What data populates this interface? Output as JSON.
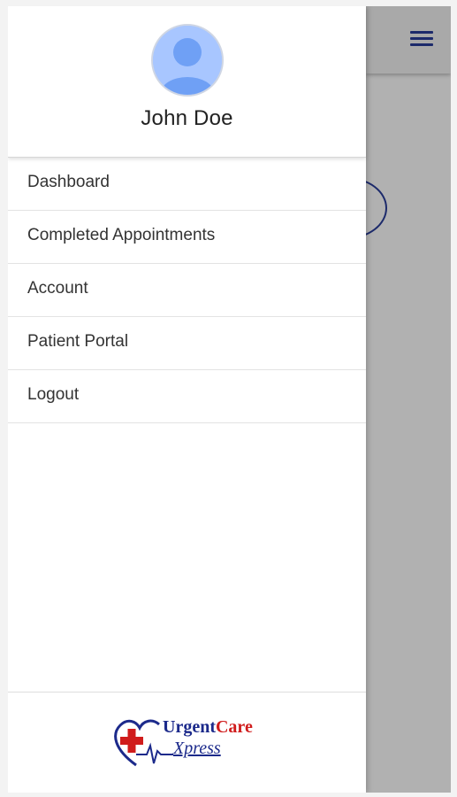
{
  "user": {
    "name": "John Doe"
  },
  "menu": {
    "items": [
      {
        "label": "Dashboard"
      },
      {
        "label": "Completed Appointments"
      },
      {
        "label": "Account"
      },
      {
        "label": "Patient Portal"
      },
      {
        "label": "Logout"
      }
    ]
  },
  "logo": {
    "urgent": "Urgent",
    "care": "Care",
    "xpress": "Xpress"
  },
  "colors": {
    "brand_blue": "#1c2a8b",
    "brand_red": "#d01c1c",
    "overlay": "#b1b1b1"
  },
  "icons": {
    "menu": "hamburger-icon",
    "avatar": "user-avatar-icon"
  }
}
